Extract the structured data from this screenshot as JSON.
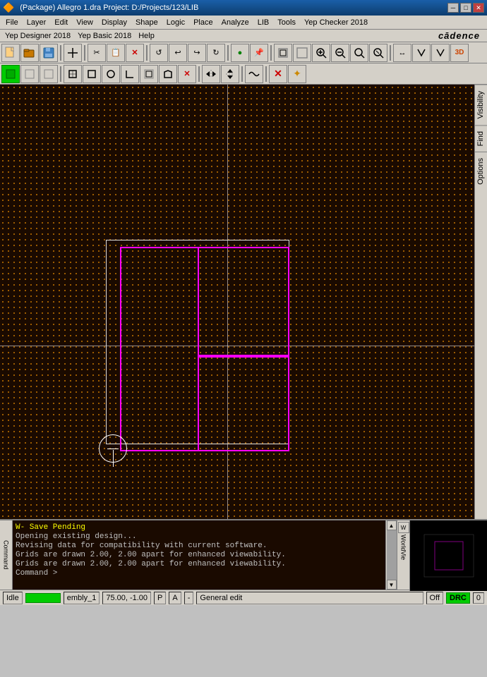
{
  "titlebar": {
    "title": "(Package) Allegro 1.dra  Project: D:/Projects/123/LIB",
    "minimize": "─",
    "restore": "□",
    "close": "✕"
  },
  "menubar1": {
    "items": [
      "File",
      "Layer",
      "Edit",
      "View",
      "Display",
      "Shape",
      "Logic",
      "Place",
      "Analyze",
      "LIB",
      "Tools",
      "Yep Checker 2018"
    ]
  },
  "menubar2": {
    "items": [
      "Yep Designer 2018",
      "Yep Basic 2018",
      "Help"
    ],
    "logo": "cādence"
  },
  "console": {
    "lines": [
      "W- Save Pending",
      "Opening existing design...",
      "Revising data for compatibility with current software.",
      "Grids are drawn 2.00, 2.00 apart for enhanced viewability.",
      "Grids are drawn 2.00, 2.00 apart for enhanced viewability.",
      "Command >"
    ]
  },
  "statusbar": {
    "idle": "Idle",
    "coords": "75.00, -1.00",
    "design": "embly_1",
    "mode": "P",
    "mode2": "A",
    "sep": "-",
    "edit_mode": "General edit",
    "off": "Off",
    "drc": "DRC",
    "num": "0"
  },
  "panels": {
    "visibility": "Visibility",
    "find": "Find",
    "options": "Options"
  },
  "toolbar1_buttons": [
    {
      "name": "new",
      "label": "🗋",
      "active": false
    },
    {
      "name": "open",
      "label": "📂",
      "active": false
    },
    {
      "name": "save",
      "label": "💾",
      "active": false
    },
    {
      "name": "sep1",
      "label": "",
      "sep": true
    },
    {
      "name": "crosshair",
      "label": "✛",
      "active": false
    },
    {
      "name": "sep2",
      "label": "",
      "sep": true
    },
    {
      "name": "cut",
      "label": "✂",
      "active": false
    },
    {
      "name": "paste",
      "label": "📋",
      "active": false
    },
    {
      "name": "delete",
      "label": "✕",
      "active": false
    },
    {
      "name": "sep3",
      "label": "",
      "sep": true
    },
    {
      "name": "undo",
      "label": "↺",
      "active": false
    },
    {
      "name": "undo2",
      "label": "↩",
      "active": false
    },
    {
      "name": "redo",
      "label": "↻",
      "active": false
    },
    {
      "name": "redo2",
      "label": "↪",
      "active": false
    },
    {
      "name": "sep4",
      "label": "",
      "sep": true
    },
    {
      "name": "run",
      "label": "▶",
      "active": false
    },
    {
      "name": "pin",
      "label": "📌",
      "active": false
    },
    {
      "name": "sep5",
      "label": "",
      "sep": true
    },
    {
      "name": "tool1",
      "label": "⬜",
      "active": false
    },
    {
      "name": "tool2",
      "label": "⬜",
      "active": false
    },
    {
      "name": "tool3",
      "label": "🔍",
      "active": false
    },
    {
      "name": "tool4",
      "label": "🔍",
      "active": false
    },
    {
      "name": "tool5",
      "label": "🔍",
      "active": false
    },
    {
      "name": "tool6",
      "label": "🔍",
      "active": false
    },
    {
      "name": "sep6",
      "label": "",
      "sep": true
    },
    {
      "name": "tool7",
      "label": "↔",
      "active": false
    },
    {
      "name": "tool8",
      "label": "⬜",
      "active": false
    },
    {
      "name": "tool9",
      "label": "⬜",
      "active": false
    },
    {
      "name": "tool10",
      "label": "3D",
      "active": false
    }
  ],
  "toolbar2_buttons": [
    {
      "name": "active-btn",
      "label": "■",
      "active": true
    },
    {
      "name": "t2b2",
      "label": "□",
      "active": false
    },
    {
      "name": "t2b3",
      "label": "□",
      "active": false
    },
    {
      "name": "sep1",
      "sep": true
    },
    {
      "name": "t2b4",
      "label": "⊡",
      "active": false
    },
    {
      "name": "t2b5",
      "label": "□",
      "active": false
    },
    {
      "name": "t2b6",
      "label": "●",
      "active": false
    },
    {
      "name": "t2b7",
      "label": "⌐",
      "active": false
    },
    {
      "name": "t2b8",
      "label": "□",
      "active": false
    },
    {
      "name": "t2b9",
      "label": "□",
      "active": false
    },
    {
      "name": "t2b10",
      "label": "✕",
      "active": false
    },
    {
      "name": "sep2",
      "sep": true
    },
    {
      "name": "t2b11",
      "label": "⟺",
      "active": false
    },
    {
      "name": "t2b12",
      "label": "⟺",
      "active": false
    },
    {
      "name": "sep3",
      "sep": true
    },
    {
      "name": "t2b13",
      "label": "〜",
      "active": false
    },
    {
      "name": "sep4",
      "sep": true
    },
    {
      "name": "t2b14",
      "label": "✕",
      "active": false
    },
    {
      "name": "t2b15",
      "label": "✦",
      "active": false
    }
  ]
}
